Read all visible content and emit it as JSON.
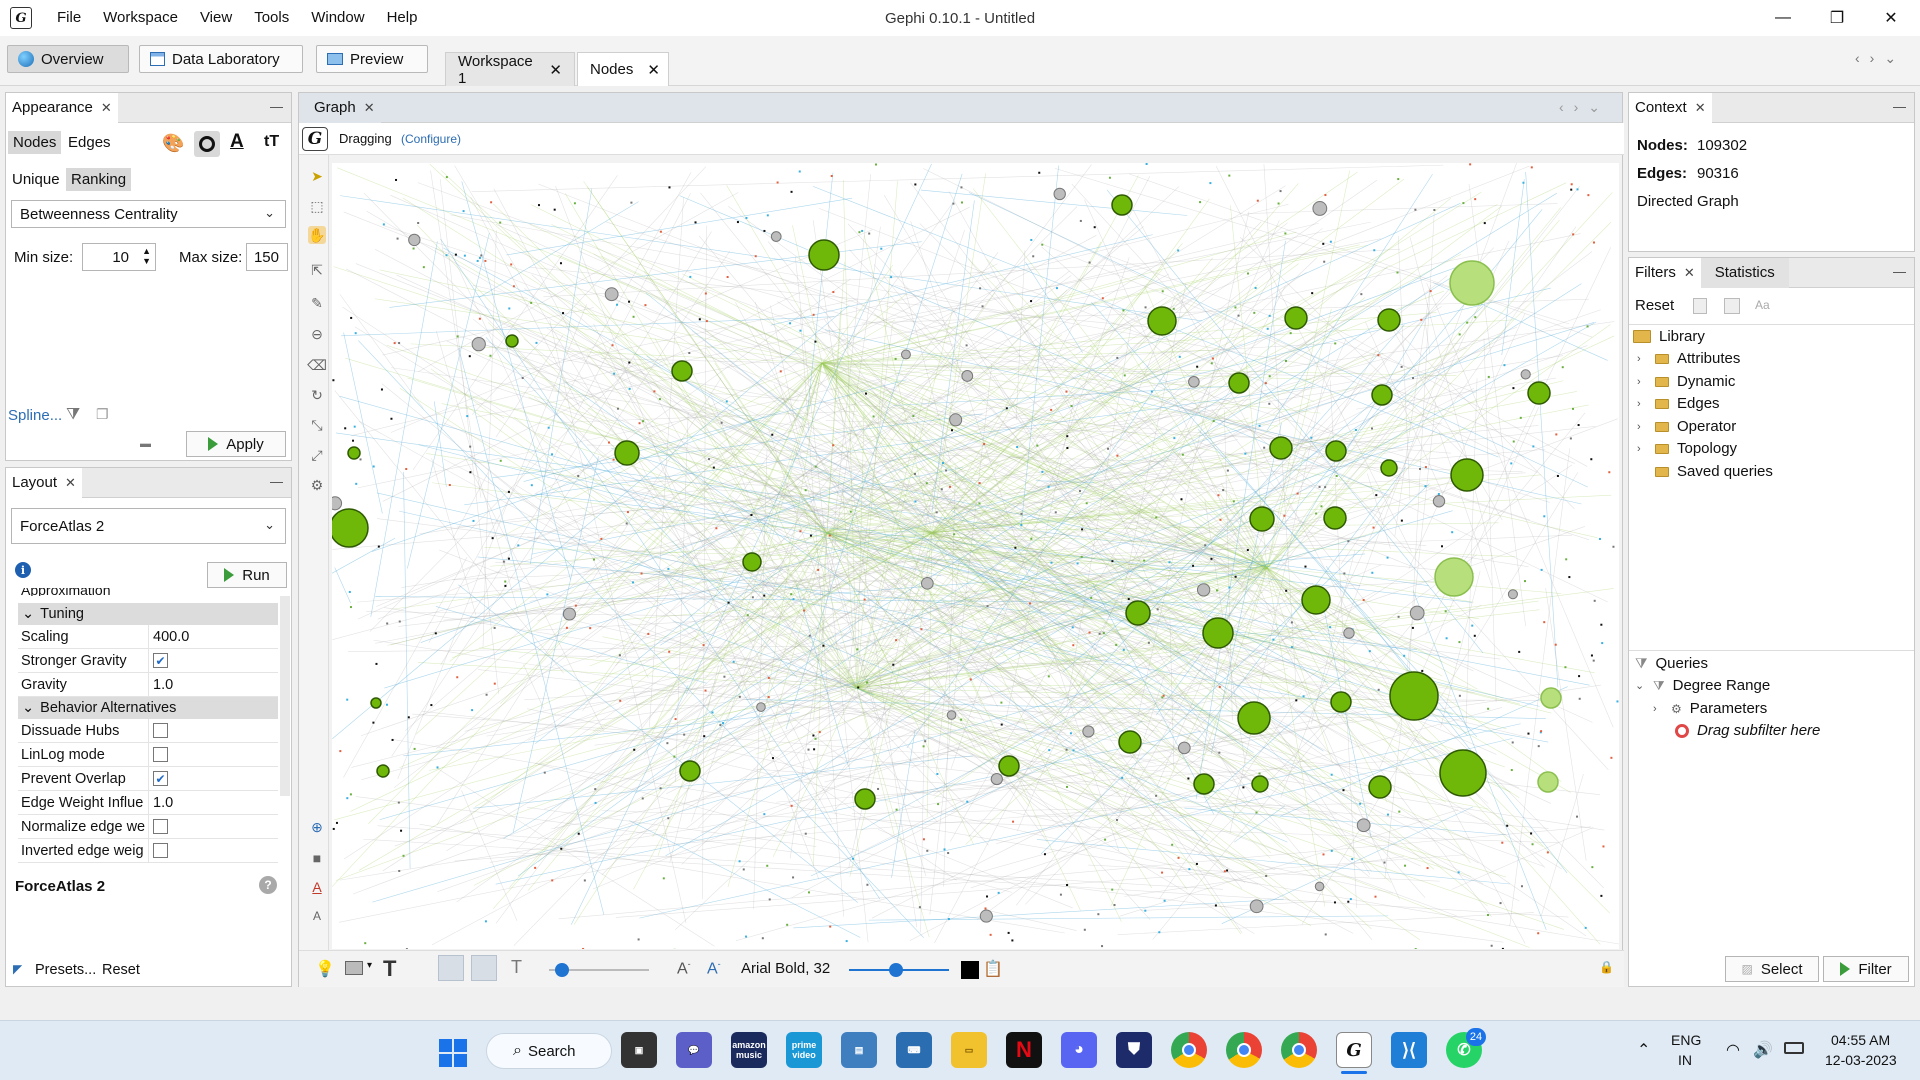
{
  "window": {
    "title": "Gephi 0.10.1 - Untitled"
  },
  "menu": [
    "File",
    "Workspace",
    "View",
    "Tools",
    "Window",
    "Help"
  ],
  "toolbar": {
    "overview": "Overview",
    "data_laboratory": "Data Laboratory",
    "preview": "Preview"
  },
  "doc_tabs": [
    "Workspace 1",
    "Nodes"
  ],
  "appearance": {
    "tab": "Appearance",
    "element_tabs": [
      "Nodes",
      "Edges"
    ],
    "mode_tabs": [
      "Unique",
      "Ranking"
    ],
    "attribute": "Betweenness Centrality",
    "min_size_label": "Min size:",
    "min_size": "10",
    "max_size_label": "Max size:",
    "max_size": "150",
    "spline": "Spline...",
    "apply": "Apply"
  },
  "layout": {
    "tab": "Layout",
    "algorithm": "ForceAtlas 2",
    "run": "Run",
    "cut_row": "Approximation",
    "sections": {
      "tuning": "Tuning",
      "behavior": "Behavior Alternatives"
    },
    "props_tuning": [
      {
        "name": "Scaling",
        "value": "400.0"
      },
      {
        "name": "Stronger Gravity",
        "checked": true
      },
      {
        "name": "Gravity",
        "value": "1.0"
      }
    ],
    "props_behavior": [
      {
        "name": "Dissuade Hubs",
        "checked": false
      },
      {
        "name": "LinLog mode",
        "checked": false
      },
      {
        "name": "Prevent Overlap",
        "checked": true
      },
      {
        "name": "Edge Weight Influe",
        "value": "1.0"
      },
      {
        "name": "Normalize edge we",
        "checked": false
      },
      {
        "name": "Inverted edge weig",
        "checked": false
      }
    ],
    "footer_title": "ForceAtlas 2",
    "presets": "Presets...",
    "reset": "Reset"
  },
  "graph": {
    "tab": "Graph",
    "mode": "Dragging",
    "configure": "(Configure)",
    "font_label": "Arial Bold, 32",
    "colors": {
      "node": "#6fb80a",
      "node_light": "#b7e07c",
      "node_stroke": "#2f5a03",
      "edge_green": "#9bcc55",
      "edge_blue": "#4aa8d8",
      "edge_gray": "#9a9a9a"
    }
  },
  "context": {
    "tab": "Context",
    "nodes_label": "Nodes:",
    "nodes": "109302",
    "edges_label": "Edges:",
    "edges": "90316",
    "graph_type": "Directed Graph"
  },
  "filters": {
    "tabs": [
      "Filters",
      "Statistics"
    ],
    "reset": "Reset",
    "library": "Library",
    "library_items": [
      "Attributes",
      "Dynamic",
      "Edges",
      "Operator",
      "Topology",
      "Saved queries"
    ],
    "queries": "Queries",
    "query": "Degree Range",
    "parameters": "Parameters",
    "drag_hint": "Drag subfilter here",
    "select": "Select",
    "filter": "Filter"
  },
  "taskbar": {
    "search": "Search",
    "lang1": "ENG",
    "lang2": "IN",
    "time": "04:55 AM",
    "date": "12-03-2023",
    "whatsapp_badge": "24",
    "app_labels": {
      "amazon_music": "amazon music",
      "prime_video": "prime video"
    }
  }
}
